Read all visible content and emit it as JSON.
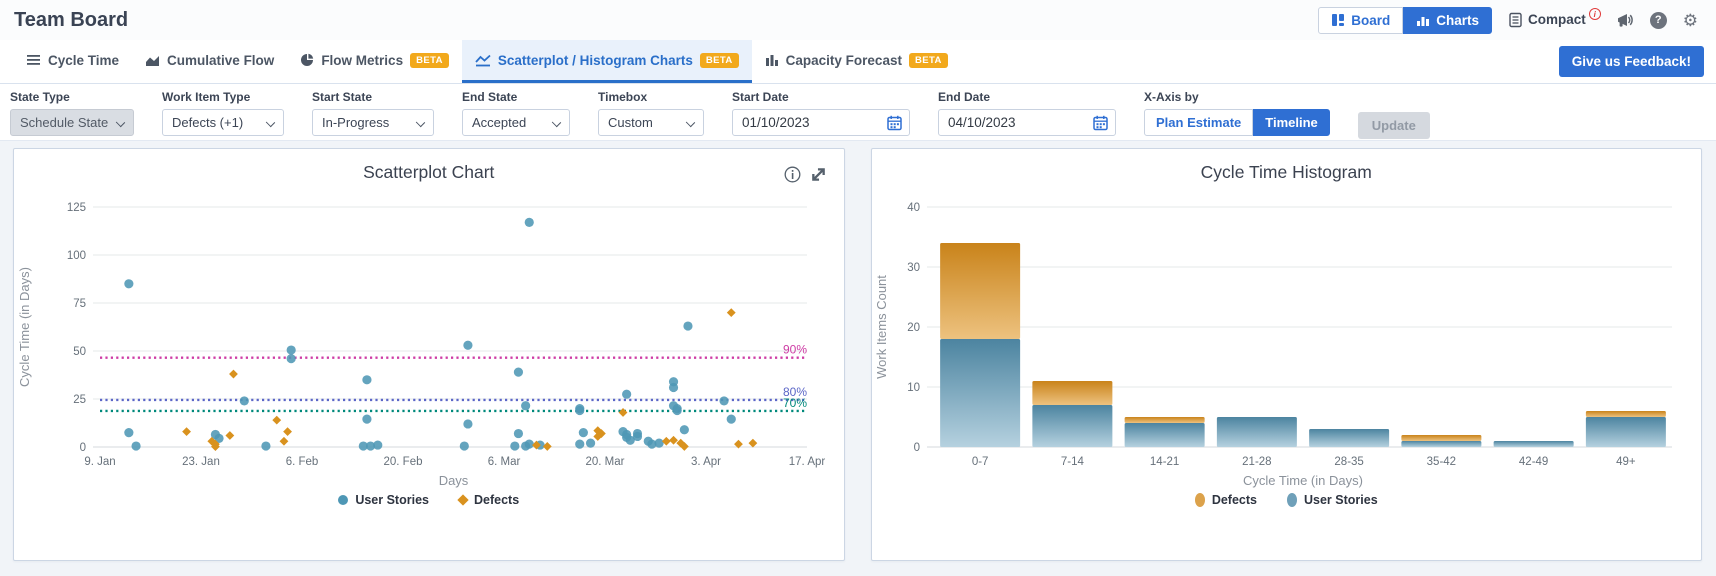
{
  "header": {
    "title": "Team Board",
    "view_toggle": {
      "board": "Board",
      "charts": "Charts",
      "active": "Charts"
    },
    "compact_label": "Compact"
  },
  "tab_bar": {
    "beta_label": "BETA",
    "tabs": [
      {
        "label": "Cycle Time",
        "beta": false,
        "active": false
      },
      {
        "label": "Cumulative Flow",
        "beta": false,
        "active": false
      },
      {
        "label": "Flow Metrics",
        "beta": true,
        "active": false
      },
      {
        "label": "Scatterplot / Histogram Charts",
        "beta": true,
        "active": true
      },
      {
        "label": "Capacity Forecast",
        "beta": true,
        "active": false
      }
    ],
    "feedback_button": "Give us Feedback!"
  },
  "filters": {
    "state_type": {
      "label": "State Type",
      "value": "Schedule State",
      "disabled": true
    },
    "work_item_type": {
      "label": "Work Item Type",
      "value": "Defects (+1)"
    },
    "start_state": {
      "label": "Start State",
      "value": "In-Progress"
    },
    "end_state": {
      "label": "End State",
      "value": "Accepted"
    },
    "timebox": {
      "label": "Timebox",
      "value": "Custom"
    },
    "start_date": {
      "label": "Start Date",
      "value": "01/10/2023"
    },
    "end_date": {
      "label": "End Date",
      "value": "04/10/2023"
    },
    "x_axis_by": {
      "label": "X-Axis by",
      "options": [
        "Plan Estimate",
        "Timeline"
      ],
      "selected": "Timeline"
    },
    "update_button": "Update"
  },
  "chart_data": [
    {
      "type": "scatter",
      "title": "Scatterplot Chart",
      "xlabel": "Days",
      "ylabel": "Cycle Time (in Days)",
      "ylim": [
        0,
        129
      ],
      "y_ticks": [
        0,
        25,
        50,
        75,
        100,
        125
      ],
      "x_ticks": [
        {
          "label": "9. Jan",
          "day": 0
        },
        {
          "label": "23. Jan",
          "day": 14
        },
        {
          "label": "6. Feb",
          "day": 28
        },
        {
          "label": "20. Feb",
          "day": 42
        },
        {
          "label": "6. Mar",
          "day": 56
        },
        {
          "label": "20. Mar",
          "day": 70
        },
        {
          "label": "3. Apr",
          "day": 84
        },
        {
          "label": "17. Apr",
          "day": 98
        }
      ],
      "percentiles": [
        {
          "label": "90%",
          "value": 46.5,
          "color": "#ce3da5"
        },
        {
          "label": "80%",
          "value": 24.5,
          "color": "#5b66c7"
        },
        {
          "label": "70%",
          "value": 18.8,
          "color": "#00897b"
        }
      ],
      "series": [
        {
          "name": "User Stories",
          "marker": "circle",
          "color": "#4e97b5",
          "points": [
            [
              4,
              85
            ],
            [
              4,
              7.5
            ],
            [
              5,
              0.5
            ],
            [
              16,
              6.5
            ],
            [
              16.5,
              4.5
            ],
            [
              20,
              24
            ],
            [
              23,
              0.5
            ],
            [
              26.5,
              50.5
            ],
            [
              26.5,
              46
            ],
            [
              37,
              35
            ],
            [
              37,
              14.5
            ],
            [
              36.5,
              0.5
            ],
            [
              37.5,
              0.5
            ],
            [
              38.5,
              1
            ],
            [
              51,
              53
            ],
            [
              51,
              12
            ],
            [
              50.5,
              0.5
            ],
            [
              58,
              39
            ],
            [
              58,
              7
            ],
            [
              57.5,
              0.5
            ],
            [
              59,
              0.5
            ],
            [
              59.5,
              1.5
            ],
            [
              59.5,
              117
            ],
            [
              59,
              21.5
            ],
            [
              61,
              1
            ],
            [
              66.5,
              20
            ],
            [
              66.5,
              19
            ],
            [
              67,
              7.5
            ],
            [
              66.5,
              1.5
            ],
            [
              68,
              2
            ],
            [
              73,
              27.5
            ],
            [
              72.5,
              8
            ],
            [
              73,
              6.5
            ],
            [
              73,
              5
            ],
            [
              73.5,
              3.5
            ],
            [
              74.5,
              7
            ],
            [
              74.5,
              5.5
            ],
            [
              76,
              3
            ],
            [
              76.5,
              1.5
            ],
            [
              77.5,
              2
            ],
            [
              79.5,
              34
            ],
            [
              79.5,
              31
            ],
            [
              79.5,
              21.5
            ],
            [
              80,
              20
            ],
            [
              80,
              19
            ],
            [
              81.5,
              63
            ],
            [
              81,
              9
            ],
            [
              86.5,
              24
            ],
            [
              87.5,
              14.5
            ]
          ]
        },
        {
          "name": "Defects",
          "marker": "diamond",
          "color": "#d9921e",
          "points": [
            [
              12,
              8
            ],
            [
              15.5,
              3
            ],
            [
              16,
              1.5
            ],
            [
              16,
              0.2
            ],
            [
              18,
              6
            ],
            [
              18.5,
              38
            ],
            [
              24.5,
              14
            ],
            [
              25.5,
              3
            ],
            [
              26,
              8
            ],
            [
              60.5,
              1
            ],
            [
              62,
              0.3
            ],
            [
              69,
              8.5
            ],
            [
              69.5,
              7
            ],
            [
              69,
              5.5
            ],
            [
              72.5,
              18
            ],
            [
              78.5,
              3
            ],
            [
              79.5,
              3.5
            ],
            [
              80.5,
              2
            ],
            [
              81,
              0.3
            ],
            [
              87.5,
              70
            ],
            [
              88.5,
              1.5
            ],
            [
              90.5,
              2
            ]
          ]
        }
      ],
      "legend": [
        "User Stories",
        "Defects"
      ]
    },
    {
      "type": "bar",
      "title": "Cycle Time Histogram",
      "xlabel": "Cycle Time (in Days)",
      "ylabel": "Work Items Count",
      "categories": [
        "0-7",
        "7-14",
        "14-21",
        "21-28",
        "28-35",
        "35-42",
        "42-49",
        "49+"
      ],
      "ylim": [
        0,
        40
      ],
      "y_ticks": [
        0,
        10,
        20,
        30,
        40
      ],
      "series": [
        {
          "name": "User Stories",
          "values": [
            18,
            7,
            4,
            5,
            3,
            1,
            1,
            5
          ],
          "color_top": "#4c84a0",
          "color_bottom": "#b5d1df"
        },
        {
          "name": "Defects",
          "values": [
            16,
            4,
            1,
            0,
            0,
            1,
            0,
            1
          ],
          "color_top": "#c9831a",
          "color_bottom": "#edc27f"
        }
      ],
      "legend": [
        "Defects",
        "User Stories"
      ]
    }
  ],
  "colors": {
    "accent_blue": "#2f6fd3",
    "user_stories": "#4e97b5",
    "defects": "#d9921e",
    "beta_badge": "#f2a91c"
  }
}
